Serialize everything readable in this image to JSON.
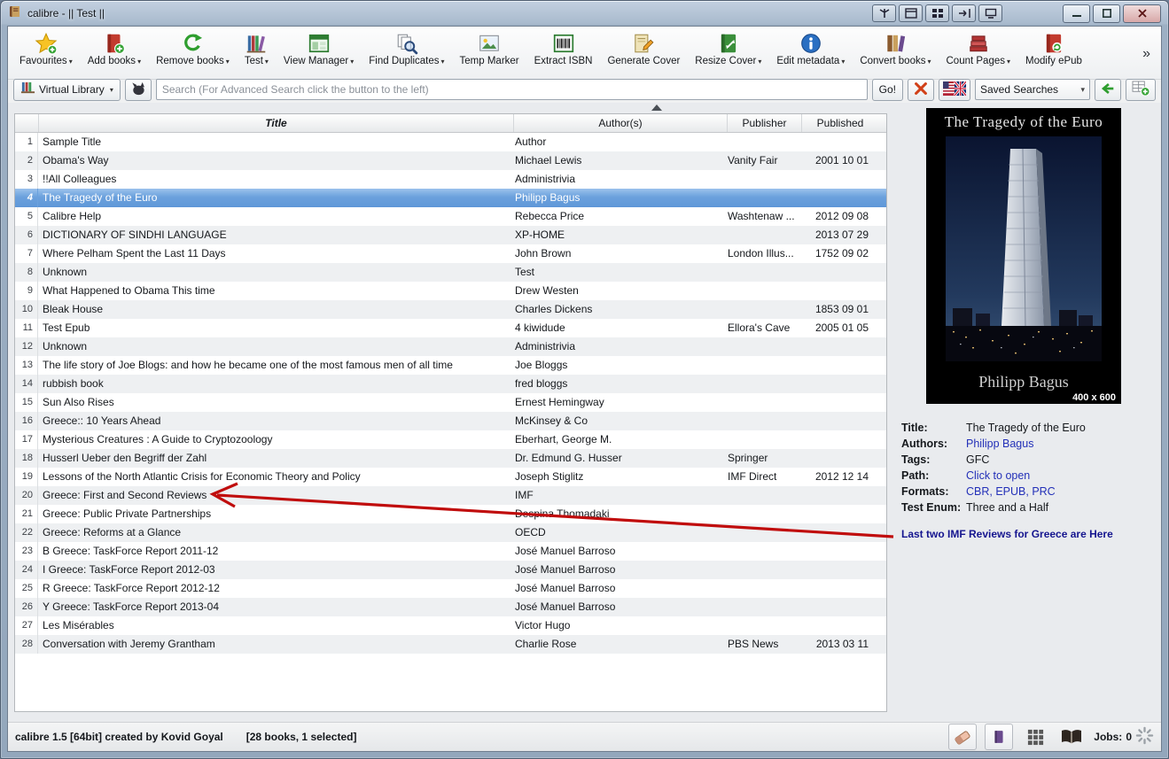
{
  "window": {
    "title": "calibre - || Test ||"
  },
  "titlebar": {
    "plugin_buttons": [
      "branch",
      "panel",
      "gridsm",
      "transfer",
      "monitor"
    ]
  },
  "toolbar": {
    "overflow": "»",
    "items": [
      {
        "label": "Favourites",
        "icon": "star",
        "dropdown": true
      },
      {
        "label": "Add books",
        "icon": "add-book",
        "dropdown": true
      },
      {
        "label": "Remove books",
        "icon": "recycle",
        "dropdown": true
      },
      {
        "label": "Test",
        "icon": "bookshelf",
        "dropdown": true
      },
      {
        "label": "View Manager",
        "icon": "window",
        "dropdown": true
      },
      {
        "label": "Find Duplicates",
        "icon": "duplicates",
        "dropdown": true
      },
      {
        "label": "Temp Marker",
        "icon": "picture",
        "dropdown": false
      },
      {
        "label": "Extract ISBN",
        "icon": "barcode",
        "dropdown": false
      },
      {
        "label": "Generate Cover",
        "icon": "cover-pencil",
        "dropdown": false
      },
      {
        "label": "Resize Cover",
        "icon": "green-book",
        "dropdown": true
      },
      {
        "label": "Edit metadata",
        "icon": "info",
        "dropdown": true
      },
      {
        "label": "Convert books",
        "icon": "convert",
        "dropdown": true
      },
      {
        "label": "Count Pages",
        "icon": "pages",
        "dropdown": true
      },
      {
        "label": "Modify ePub",
        "icon": "epub",
        "dropdown": false
      }
    ]
  },
  "search": {
    "virtual_library_label": "Virtual Library",
    "placeholder": "Search (For Advanced Search click the button to the left)",
    "go_label": "Go!",
    "saved_searches_label": "Saved Searches"
  },
  "table": {
    "headers": {
      "title": "Title",
      "authors": "Author(s)",
      "publisher": "Publisher",
      "published": "Published"
    },
    "rows": [
      {
        "num": 1,
        "title": "Sample Title",
        "authors": "Author",
        "publisher": "",
        "published": "",
        "selected": false
      },
      {
        "num": 2,
        "title": "Obama's Way",
        "authors": "Michael Lewis",
        "publisher": "Vanity Fair",
        "published": "2001 10 01",
        "selected": false
      },
      {
        "num": 3,
        "title": "!!All Colleagues",
        "authors": "Administrivia",
        "publisher": "",
        "published": "",
        "selected": false
      },
      {
        "num": 4,
        "title": "The Tragedy of the Euro",
        "authors": "Philipp Bagus",
        "publisher": "",
        "published": "",
        "selected": true
      },
      {
        "num": 5,
        "title": "Calibre Help",
        "authors": "Rebecca Price",
        "publisher": "Washtenaw ...",
        "published": "2012 09 08",
        "selected": false
      },
      {
        "num": 6,
        "title": "DICTIONARY OF SINDHI LANGUAGE",
        "authors": "XP-HOME",
        "publisher": "",
        "published": "2013 07 29",
        "selected": false
      },
      {
        "num": 7,
        "title": "Where Pelham Spent the Last 11 Days",
        "authors": "John Brown",
        "publisher": "London Illus...",
        "published": "1752 09 02",
        "selected": false
      },
      {
        "num": 8,
        "title": "Unknown",
        "authors": "Test",
        "publisher": "",
        "published": "",
        "selected": false
      },
      {
        "num": 9,
        "title": "What Happened to Obama This time",
        "authors": "Drew Westen",
        "publisher": "",
        "published": "",
        "selected": false
      },
      {
        "num": 10,
        "title": "Bleak House",
        "authors": "Charles Dickens",
        "publisher": "",
        "published": "1853 09 01",
        "selected": false
      },
      {
        "num": 11,
        "title": "Test Epub",
        "authors": "4 kiwidude",
        "publisher": "Ellora's Cave",
        "published": "2005 01 05",
        "selected": false
      },
      {
        "num": 12,
        "title": "Unknown",
        "authors": "Administrivia",
        "publisher": "",
        "published": "",
        "selected": false
      },
      {
        "num": 13,
        "title": "The life story of Joe Blogs: and how he became one of the most famous men of all time",
        "authors": "Joe Bloggs",
        "publisher": "",
        "published": "",
        "selected": false
      },
      {
        "num": 14,
        "title": "rubbish book",
        "authors": "fred bloggs",
        "publisher": "",
        "published": "",
        "selected": false
      },
      {
        "num": 15,
        "title": "Sun Also Rises",
        "authors": "Ernest Hemingway",
        "publisher": "",
        "published": "",
        "selected": false
      },
      {
        "num": 16,
        "title": "Greece:: 10 Years Ahead",
        "authors": "McKinsey & Co",
        "publisher": "",
        "published": "",
        "selected": false
      },
      {
        "num": 17,
        "title": "Mysterious Creatures : A Guide to Cryptozoology",
        "authors": "Eberhart, George M.",
        "publisher": "",
        "published": "",
        "selected": false
      },
      {
        "num": 18,
        "title": "Husserl Ueber den Begriff der Zahl",
        "authors": "Dr.  Edmund  G. Husser",
        "publisher": "Springer",
        "published": "",
        "selected": false
      },
      {
        "num": 19,
        "title": "Lessons of the North Atlantic Crisis for Economic Theory and Policy",
        "authors": "Joseph Stiglitz",
        "publisher": "IMF Direct",
        "published": "2012 12 14",
        "selected": false
      },
      {
        "num": 20,
        "title": "Greece: First and Second Reviews",
        "authors": "IMF",
        "publisher": "",
        "published": "",
        "selected": false
      },
      {
        "num": 21,
        "title": "Greece: Public Private Partnerships",
        "authors": "Despina Thomadaki",
        "publisher": "",
        "published": "",
        "selected": false
      },
      {
        "num": 22,
        "title": "Greece: Reforms at a Glance",
        "authors": "OECD",
        "publisher": "",
        "published": "",
        "selected": false
      },
      {
        "num": 23,
        "title": "B Greece: TaskForce Report 2011-12",
        "authors": "José Manuel Barroso",
        "publisher": "",
        "published": "",
        "selected": false
      },
      {
        "num": 24,
        "title": "I Greece: TaskForce Report 2012-03",
        "authors": "José Manuel Barroso",
        "publisher": "",
        "published": "",
        "selected": false
      },
      {
        "num": 25,
        "title": "R Greece: TaskForce Report 2012-12",
        "authors": "José Manuel Barroso",
        "publisher": "",
        "published": "",
        "selected": false
      },
      {
        "num": 26,
        "title": "Y Greece: TaskForce Report 2013-04",
        "authors": "José Manuel Barroso",
        "publisher": "",
        "published": "",
        "selected": false
      },
      {
        "num": 27,
        "title": "Les Misérables",
        "authors": "Victor Hugo",
        "publisher": "",
        "published": "",
        "selected": false
      },
      {
        "num": 28,
        "title": "Conversation with Jeremy Grantham",
        "authors": "Charlie Rose",
        "publisher": "PBS News",
        "published": "2013 03 11",
        "selected": false
      }
    ]
  },
  "details": {
    "cover": {
      "title": "The Tragedy of the Euro",
      "author": "Philipp Bagus",
      "size": "400 x 600"
    },
    "fields": [
      {
        "label": "Title:",
        "value": "The Tragedy of the Euro",
        "link": false
      },
      {
        "label": "Authors:",
        "value": "Philipp Bagus",
        "link": true
      },
      {
        "label": "Tags:",
        "value": "GFC",
        "link": false
      },
      {
        "label": "Path:",
        "value": "Click to open",
        "link": true
      },
      {
        "label": "Formats:",
        "value": "CBR, EPUB, PRC",
        "link": true
      },
      {
        "label": "Test Enum:",
        "value": "Three and a Half",
        "link": false
      }
    ],
    "note": "Last two IMF Reviews for Greece are Here"
  },
  "statusbar": {
    "version_text": "calibre 1.5 [64bit] created by Kovid Goyal",
    "books_text": "[28 books, 1 selected]",
    "jobs_label": "Jobs:",
    "jobs_count": "0",
    "toggle_icons": [
      "tag-eraser",
      "cover-browser",
      "grid-view",
      "book-details"
    ]
  },
  "colors": {
    "selection": "#6ba1dd",
    "link": "#2330b8",
    "note_text": "#15158f",
    "annotation_arrow": "#c00d0d"
  }
}
